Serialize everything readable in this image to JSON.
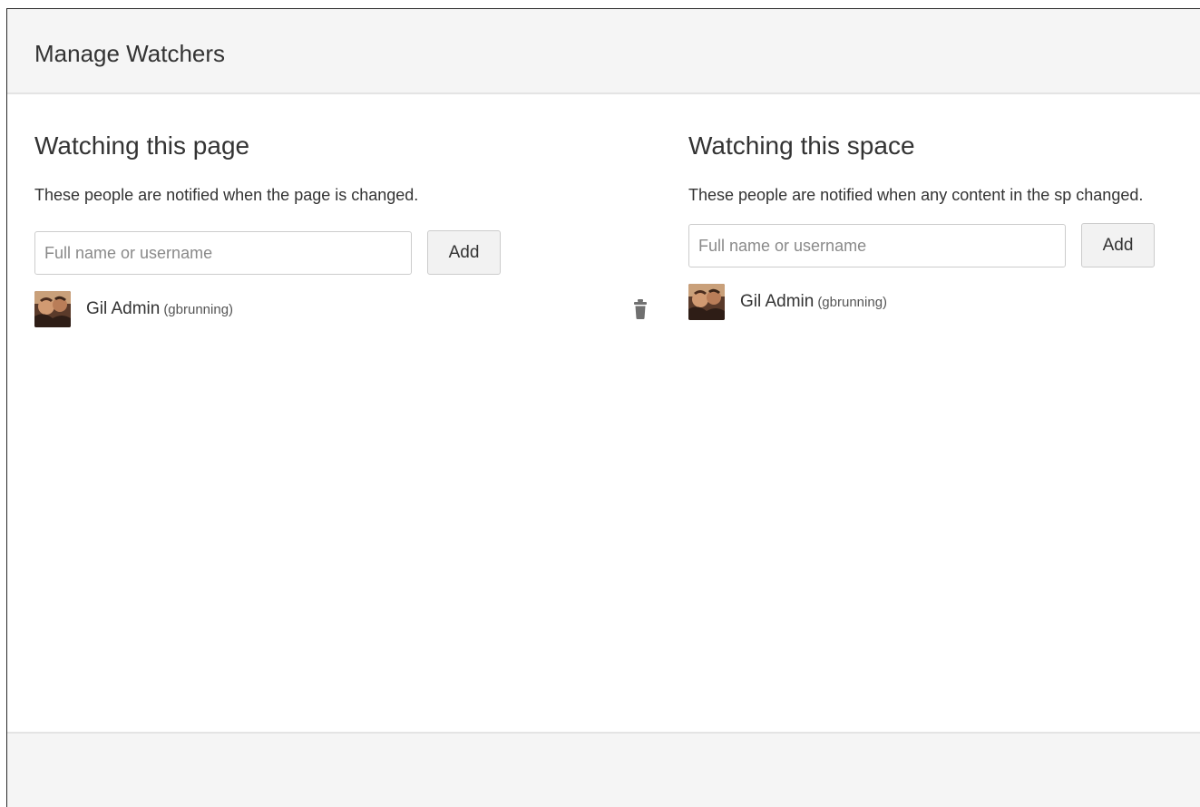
{
  "dialog": {
    "title": "Manage Watchers"
  },
  "page_watchers": {
    "heading": "Watching this page",
    "description": "These people are notified when the page is changed.",
    "input_placeholder": "Full name or username",
    "add_label": "Add",
    "watchers": [
      {
        "name": "Gil Admin",
        "username": "(gbrunning)",
        "avatar_icon": "user-avatar-icon",
        "remove_icon": "trash-icon"
      }
    ]
  },
  "space_watchers": {
    "heading": "Watching this space",
    "description": "These people are notified when any content in the sp changed.",
    "input_placeholder": "Full name or username",
    "add_label": "Add",
    "watchers": [
      {
        "name": "Gil Admin",
        "username": "(gbrunning)",
        "avatar_icon": "user-avatar-icon"
      }
    ]
  },
  "colors": {
    "header_bg": "#f5f5f5",
    "text": "#333333",
    "border": "#cccccc",
    "button_bg": "#f2f2f2",
    "icon": "#707070"
  }
}
